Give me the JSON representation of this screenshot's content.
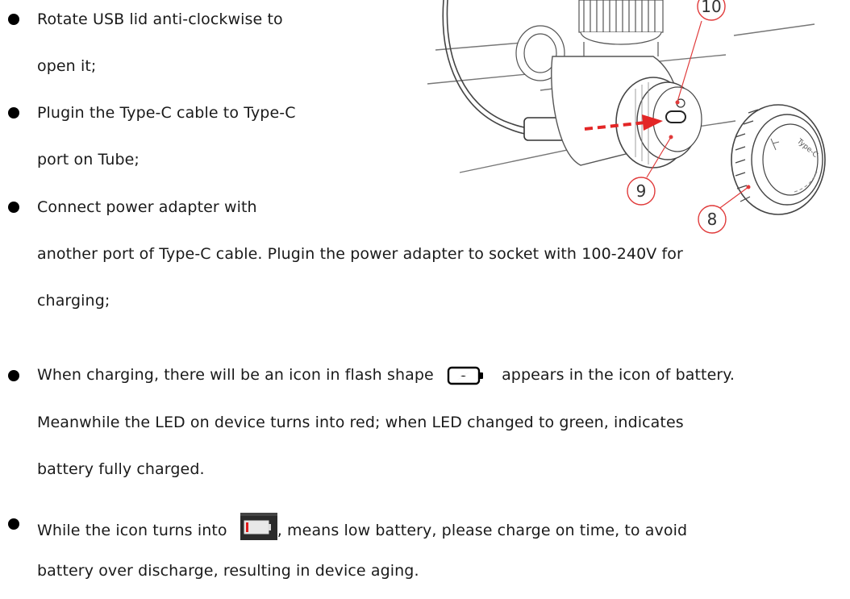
{
  "bullets": [
    {
      "lines": [
        "Rotate USB lid anti-clockwise to",
        "open it;"
      ]
    },
    {
      "lines": [
        "Plugin the Type-C cable to Type-C",
        "port on Tube;"
      ]
    },
    {
      "lines": [
        "Connect power adapter with",
        "another port of Type-C cable. Plugin the power adapter to socket with 100-240V for",
        "charging;"
      ]
    },
    {
      "line1_before": "When charging, there will be an icon in flash shape",
      "line1_after": "appears in the icon of battery.",
      "lines": [
        "Meanwhile the LED on device turns into red; when LED changed to green, indicates",
        "battery fully charged."
      ]
    },
    {
      "line1_before": "While the icon turns into",
      "line1_after": ", means low battery, please charge on time, to avoid",
      "lines": [
        "battery over discharge, resulting in device aging."
      ]
    }
  ],
  "figure": {
    "callouts": [
      "10",
      "9",
      "8"
    ],
    "lid_text": "Type-C"
  },
  "icons": {
    "charging_icon": "battery-charging-flash-icon",
    "low_battery_icon": "low-battery-icon"
  },
  "colors": {
    "callout_red": "#e03a3a",
    "arrow_red": "#e32626",
    "low_battery_bg": "#2b2b2b",
    "low_battery_fill": "#e01b1b"
  }
}
